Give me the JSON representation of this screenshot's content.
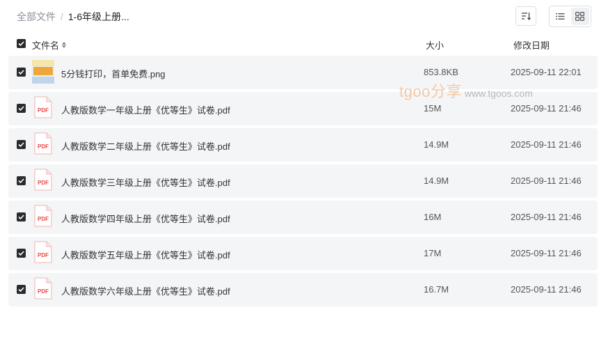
{
  "breadcrumb": {
    "root": "全部文件",
    "separator": "/",
    "current": "1-6年级上册..."
  },
  "toolbar": {
    "sort_icon": "sort-lines-icon",
    "views": [
      {
        "name": "list-view",
        "icon": "list-icon",
        "active": false
      },
      {
        "name": "grid-view",
        "icon": "grid-icon",
        "active": true
      }
    ]
  },
  "columns": {
    "name": "文件名",
    "size": "大小",
    "date": "修改日期"
  },
  "watermark": {
    "brand": "tgoo分享",
    "url": "www.tgoos.com"
  },
  "files": [
    {
      "name": "5分钱打印，首单免费.png",
      "size": "853.8KB",
      "date": "2025-09-11 22:01",
      "type": "png",
      "checked": true
    },
    {
      "name": "人教版数学一年级上册《优等生》试卷.pdf",
      "size": "15M",
      "date": "2025-09-11 21:46",
      "type": "pdf",
      "checked": true
    },
    {
      "name": "人教版数学二年级上册《优等生》试卷.pdf",
      "size": "14.9M",
      "date": "2025-09-11 21:46",
      "type": "pdf",
      "checked": true
    },
    {
      "name": "人教版数学三年级上册《优等生》试卷.pdf",
      "size": "14.9M",
      "date": "2025-09-11 21:46",
      "type": "pdf",
      "checked": true
    },
    {
      "name": "人教版数学四年级上册《优等生》试卷.pdf",
      "size": "16M",
      "date": "2025-09-11 21:46",
      "type": "pdf",
      "checked": true
    },
    {
      "name": "人教版数学五年级上册《优等生》试卷.pdf",
      "size": "17M",
      "date": "2025-09-11 21:46",
      "type": "pdf",
      "checked": true
    },
    {
      "name": "人教版数学六年级上册《优等生》试卷.pdf",
      "size": "16.7M",
      "date": "2025-09-11 21:46",
      "type": "pdf",
      "checked": true
    }
  ],
  "colors": {
    "row_bg": "#f4f5f6",
    "pdf_red": "#e84a4a",
    "checkbox": "#2b2b2b"
  }
}
